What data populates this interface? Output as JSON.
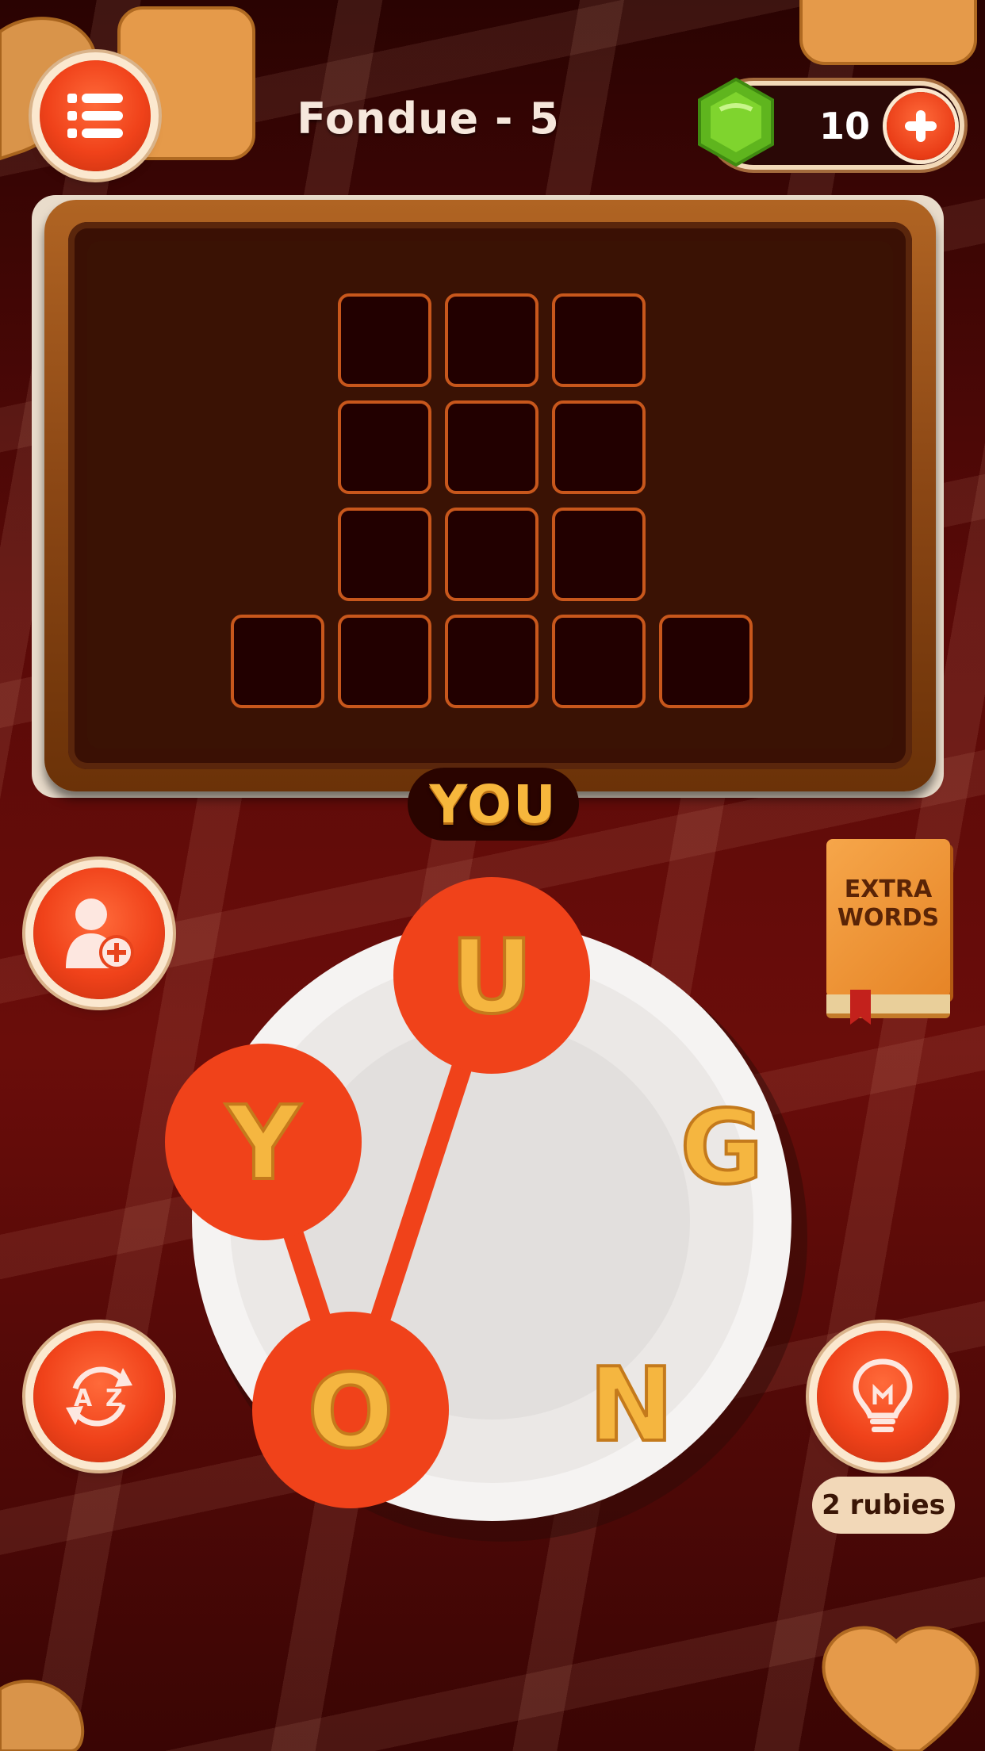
{
  "header": {
    "level_title": "Fondue - 5",
    "ruby_count": "10"
  },
  "board": {
    "rows": [
      3,
      3,
      3,
      5
    ],
    "current_word": "YOU"
  },
  "wheel": {
    "letters": [
      "U",
      "G",
      "N",
      "O",
      "Y"
    ],
    "selected": [
      "Y",
      "O",
      "U"
    ]
  },
  "side_buttons": {
    "extra_words_label": "EXTRA\nWORDS",
    "hint_cost": "2 rubies"
  },
  "colors": {
    "accent": "#f0421a",
    "letter": "#f5b640",
    "cell_border": "#c8571c"
  },
  "icons": {
    "menu": "menu-icon",
    "add": "plus-icon",
    "gem": "gem-icon",
    "invite": "add-friend-icon",
    "shuffle": "shuffle-icon",
    "hint": "lightbulb-icon",
    "extra_words": "book-icon"
  }
}
